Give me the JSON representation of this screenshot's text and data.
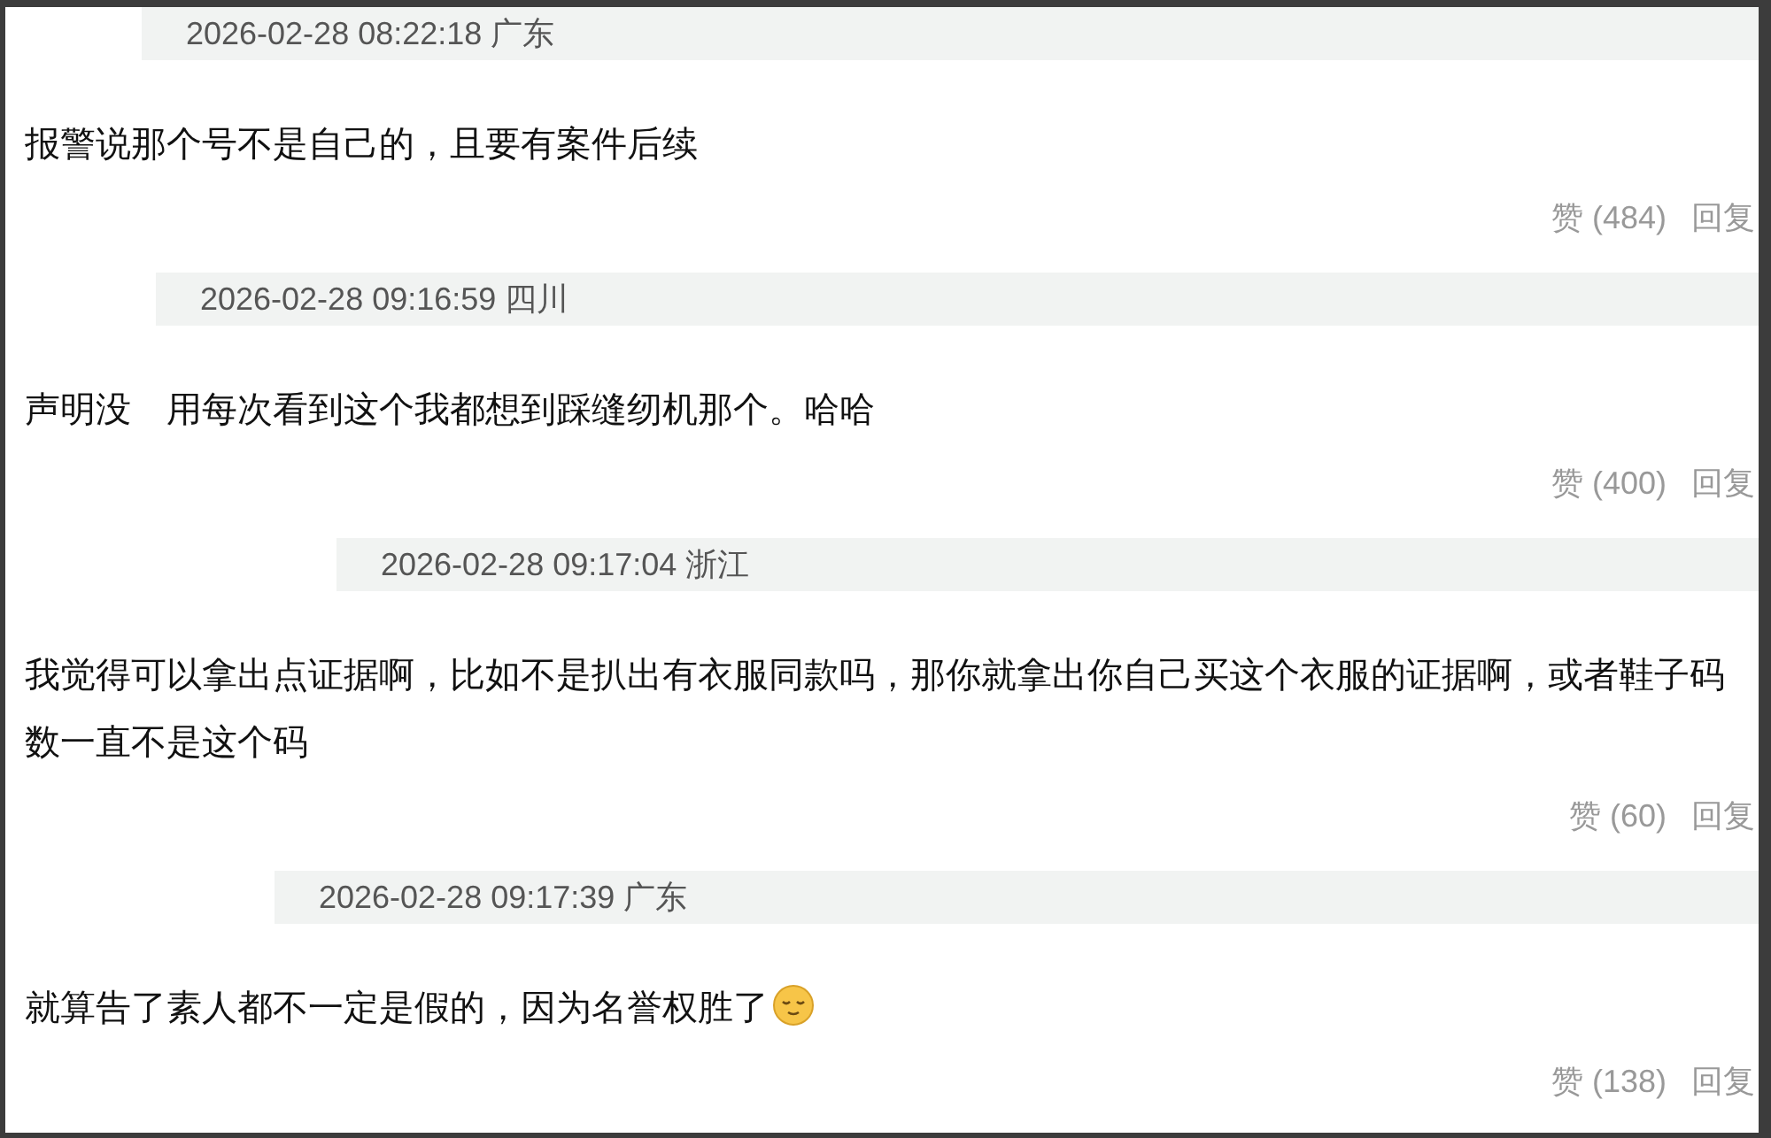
{
  "comments": [
    {
      "meta": "2026-02-28 08:22:18 广东",
      "text": "报警说那个号不是自己的，且要有案件后续",
      "likes": "赞 (484)",
      "reply": "回复"
    },
    {
      "meta": "2026-02-28 09:16:59 四川",
      "text": "声明没　用每次看到这个我都想到踩缝纫机那个。哈哈",
      "likes": "赞 (400)",
      "reply": "回复"
    },
    {
      "meta": "2026-02-28 09:17:04 浙江",
      "text": "我觉得可以拿出点证据啊，比如不是扒出有衣服同款吗，那你就拿出你自己买这个衣服的证据啊，或者鞋子码数一直不是这个码",
      "likes": "赞 (60)",
      "reply": "回复"
    },
    {
      "meta": "2026-02-28 09:17:39 广东",
      "text": "就算告了素人都不一定是假的，因为名誉权胜了",
      "emoji": true,
      "likes": "赞 (138)",
      "reply": "回复"
    }
  ]
}
